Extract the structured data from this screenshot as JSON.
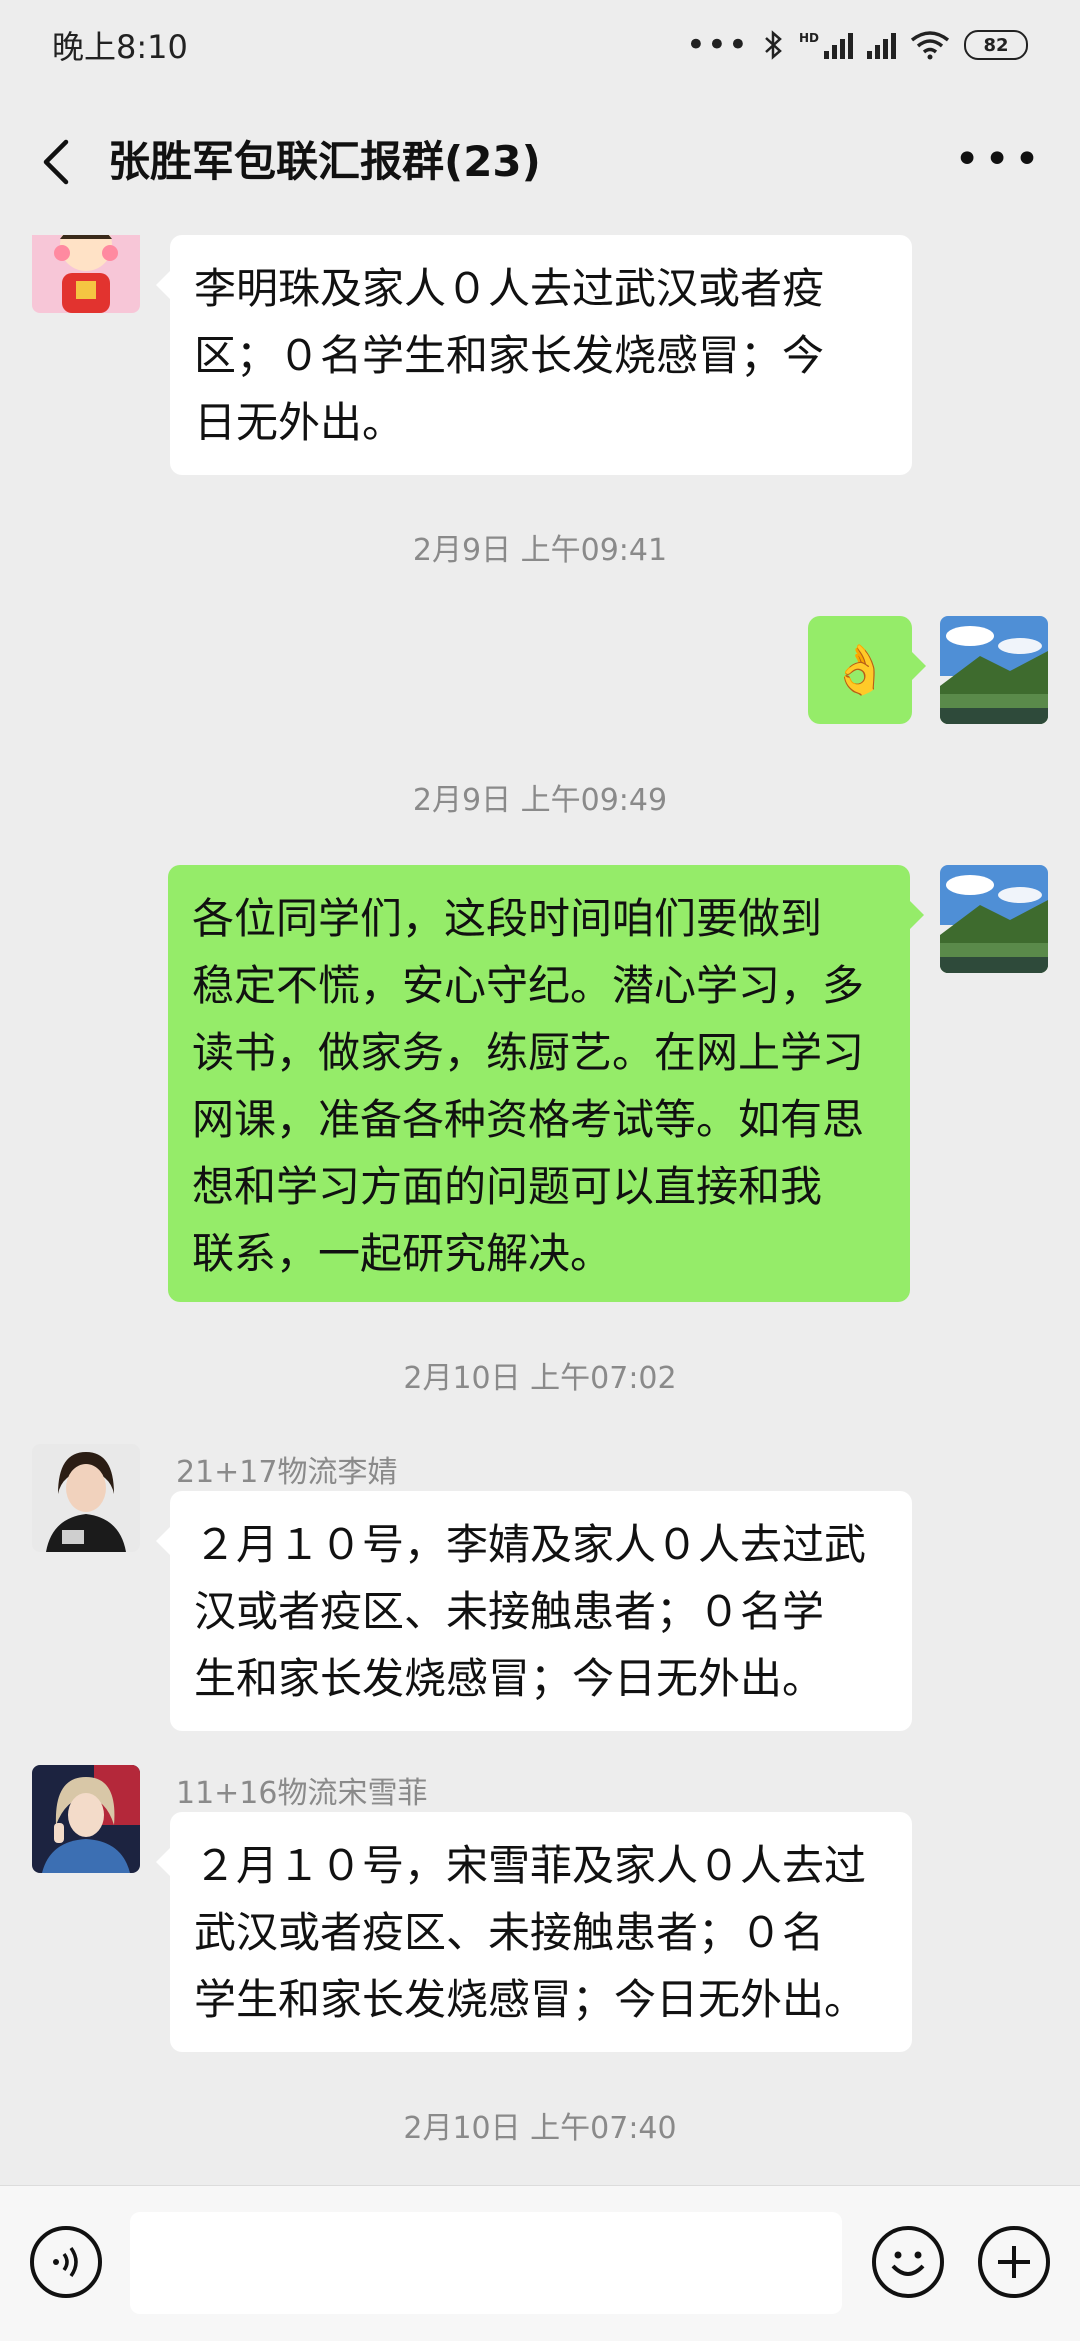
{
  "status_bar": {
    "time": "晚上8:10",
    "hd_label": "HD",
    "battery": "82"
  },
  "header": {
    "title": "张胜军包联汇报群(23)"
  },
  "messages": [
    {
      "side": "left",
      "text_lines": [
        "李明珠及家人０人去过武汉或者疫",
        "区；０名学生和家长发烧感冒；今",
        "日无外出。"
      ]
    },
    {
      "timestamp": "2月9日 上午09:41"
    },
    {
      "side": "right",
      "emoji": "👌"
    },
    {
      "timestamp": "2月9日 上午09:49"
    },
    {
      "side": "right",
      "text_lines": [
        "各位同学们，这段时间咱们要做到",
        "稳定不慌，安心守纪。潜心学习，多",
        "读书，做家务，练厨艺。在网上学习",
        "网课，准备各种资格考试等。如有思",
        "想和学习方面的问题可以直接和我",
        "联系，一起研究解决。"
      ]
    },
    {
      "timestamp": "2月10日 上午07:02"
    },
    {
      "side": "left",
      "sender": "21+17物流李婧",
      "text_lines": [
        "２月１０号，李婧及家人０人去过武",
        "汉或者疫区、未接触患者；０名学",
        "生和家长发烧感冒；今日无外出。"
      ]
    },
    {
      "side": "left",
      "sender": "11+16物流宋雪菲",
      "text_lines": [
        "２月１０号，宋雪菲及家人０人去过",
        "武汉或者疫区、未接触患者；０名",
        "学生和家长发烧感冒；今日无外出。"
      ]
    },
    {
      "timestamp": "2月10日 上午07:40"
    }
  ],
  "input_bar": {
    "value": "",
    "icons": [
      "voice-icon",
      "emoji-icon",
      "plus-icon"
    ]
  },
  "colors": {
    "background": "#ededed",
    "sent_bubble": "#95ec69",
    "received_bubble": "#ffffff",
    "timestamp_text": "#8a8a8a"
  }
}
